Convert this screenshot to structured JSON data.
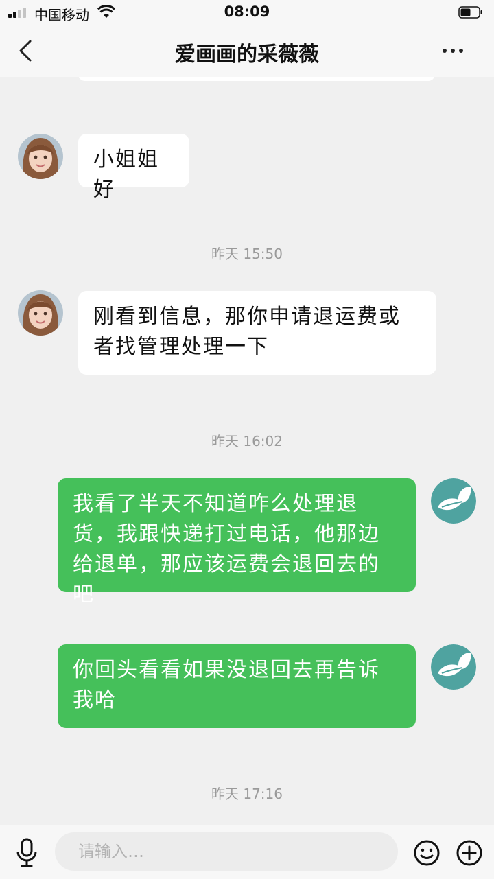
{
  "status_bar": {
    "carrier": "中国移动",
    "time": "08:09"
  },
  "nav": {
    "title": "爱画画的采薇薇",
    "back_icon": "chevron-left-icon",
    "more_icon": "more-dots-icon"
  },
  "messages": [
    {
      "side": "in",
      "text": "小姐姐好"
    },
    {
      "timestamp": "昨天 15:50"
    },
    {
      "side": "in",
      "text": "刚看到信息，那你申请退运费或者找管理处理一下"
    },
    {
      "timestamp": "昨天 16:02"
    },
    {
      "side": "out",
      "text": "我看了半天不知道咋么处理退货，我跟快递打过电话，他那边给退单，那应该运费会退回去的吧"
    },
    {
      "side": "out",
      "text": "你回头看看如果没退回去再告诉我哈"
    },
    {
      "timestamp": "昨天 17:16"
    }
  ],
  "input_bar": {
    "placeholder": "请输入…",
    "voice_icon": "microphone-icon",
    "emoji_icon": "emoji-icon",
    "add_icon": "plus-circle-icon"
  },
  "colors": {
    "outgoing_bubble": "#45c05a",
    "incoming_bubble": "#ffffff",
    "background": "#f0f0f0"
  }
}
